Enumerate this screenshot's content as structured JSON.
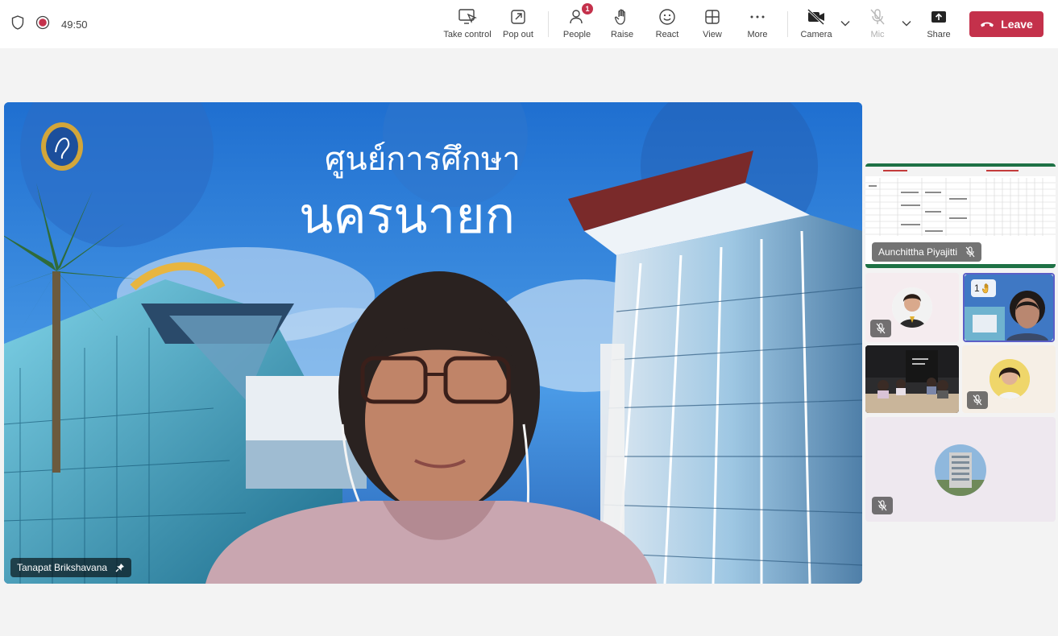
{
  "status": {
    "timer": "49:50"
  },
  "toolbar": {
    "take_control": "Take control",
    "pop_out": "Pop out",
    "people": "People",
    "people_badge": "1",
    "raise": "Raise",
    "react": "React",
    "view": "View",
    "more": "More",
    "camera": "Camera",
    "mic": "Mic",
    "share": "Share",
    "leave": "Leave"
  },
  "colors": {
    "leave": "#c4314b",
    "accent": "#5b5fc7",
    "recording": "#c4314b"
  },
  "stage": {
    "background_title_line1": "ศูนย์การศึกษา",
    "background_title_line2": "นครนายก",
    "participant_name": "Tanapat Brikshavana"
  },
  "tiles": {
    "screen_share_name": "Aunchittha Piyajitti",
    "raised_hands": "1"
  },
  "icons": [
    "shield-icon",
    "record-icon",
    "take-control-icon",
    "pop-out-icon",
    "people-icon",
    "raise-hand-icon",
    "react-icon",
    "view-icon",
    "more-icon",
    "camera-off-icon",
    "mic-off-icon",
    "share-icon",
    "phone-hangup-icon",
    "pin-icon",
    "chevron-down-icon"
  ]
}
